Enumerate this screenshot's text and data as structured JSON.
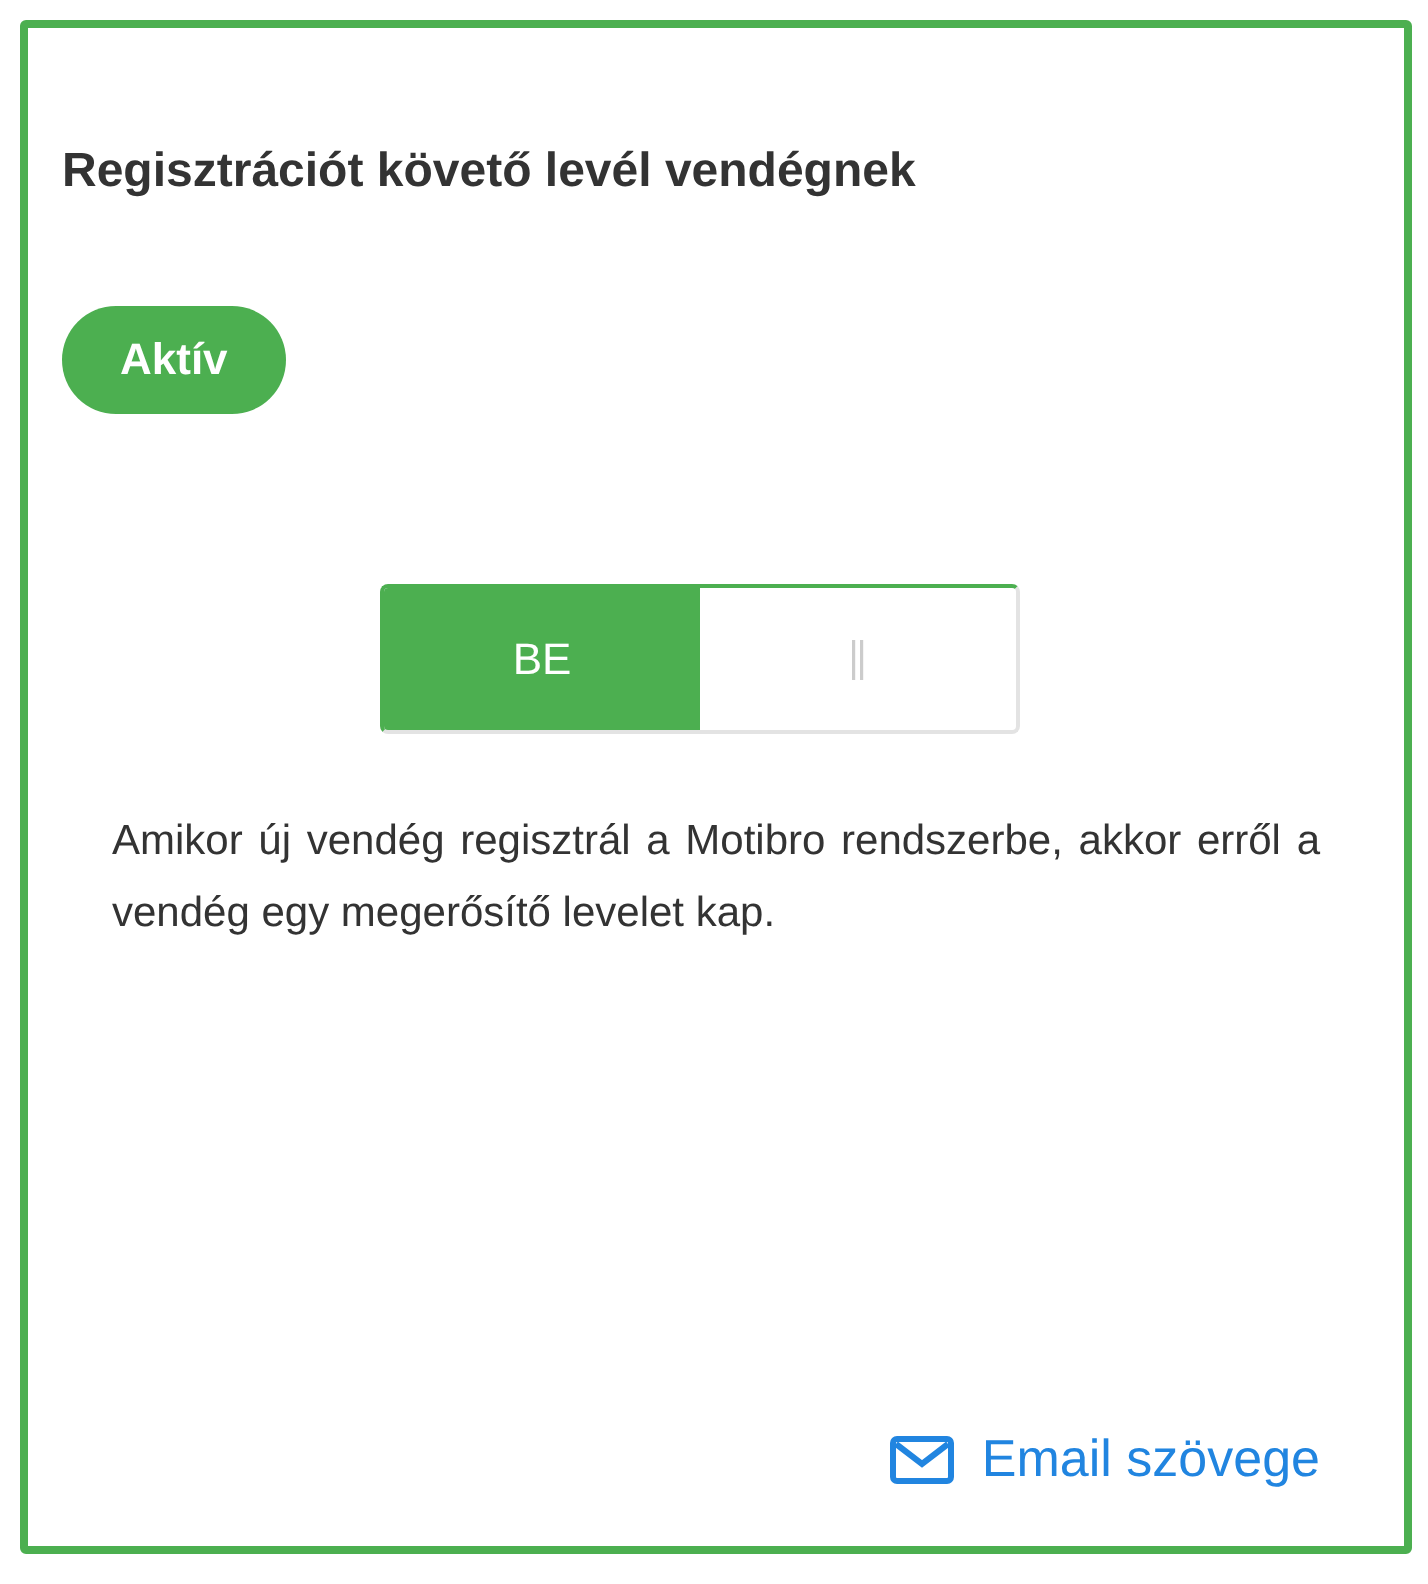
{
  "card": {
    "title": "Regisztrációt követő levél vendégnek",
    "status_badge": "Aktív",
    "toggle": {
      "on": true,
      "on_label": "BE"
    },
    "description": "Amikor új vendég regisztrál a Motibro rendszerbe, akkor erről a vendég egy megerősítő levelet kap.",
    "email_link": "Email szövege"
  }
}
